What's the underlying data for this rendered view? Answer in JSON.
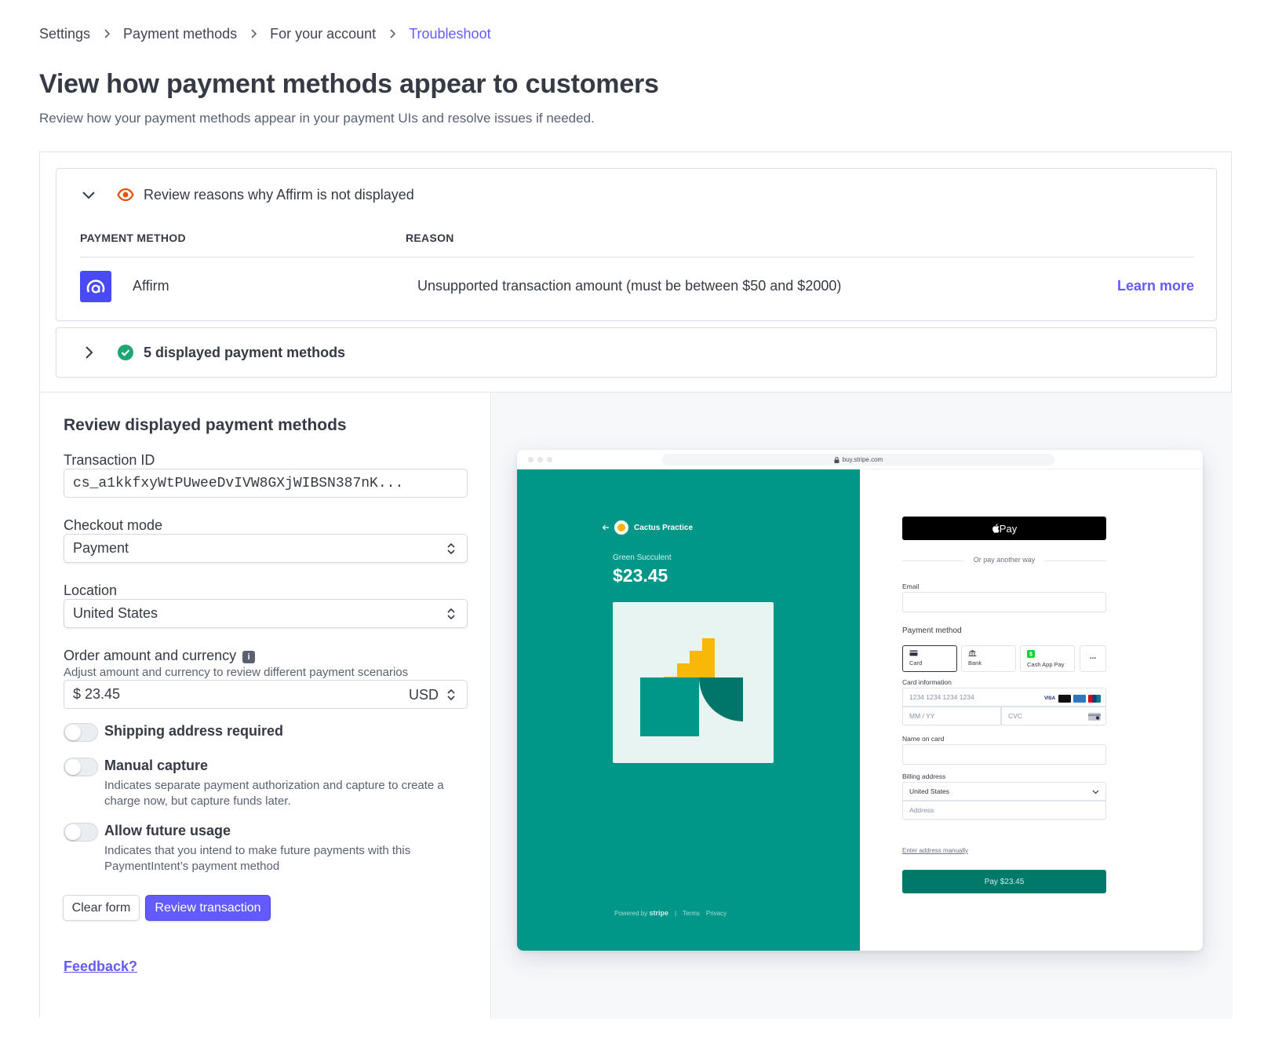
{
  "breadcrumb": {
    "items": [
      "Settings",
      "Payment methods",
      "For your account",
      "Troubleshoot"
    ]
  },
  "page": {
    "title": "View how payment methods appear to customers",
    "subtitle": "Review how your payment methods appear in your payment UIs and resolve issues if needed."
  },
  "issues": {
    "header": "Review reasons why Affirm is not displayed",
    "col_method": "PAYMENT METHOD",
    "col_reason": "REASON",
    "row": {
      "method": "Affirm",
      "reason": "Unsupported transaction amount (must be between $50 and $2000)",
      "link": "Learn more"
    }
  },
  "displayed": {
    "header": "5 displayed payment methods"
  },
  "form": {
    "title": "Review displayed payment methods",
    "transaction_label": "Transaction ID",
    "transaction_value": "cs_a1kkfxyWtPUweeDvIVW8GXjWIBSN387nK...",
    "checkout_label": "Checkout mode",
    "checkout_value": "Payment",
    "location_label": "Location",
    "location_value": "United States",
    "amount_label": "Order amount and currency",
    "amount_help": "Adjust amount and currency to review different payment scenarios",
    "amount_value": "$ 23.45",
    "currency_value": "USD",
    "toggles": [
      {
        "label": "Shipping address required",
        "desc": "",
        "on": false
      },
      {
        "label": "Manual capture",
        "desc": "Indicates separate payment authorization and capture to create a charge now, but capture funds later.",
        "on": false
      },
      {
        "label": "Allow future usage",
        "desc": "Indicates that you intend to make future payments with this PaymentIntent’s payment method",
        "on": false
      }
    ],
    "clear_button": "Clear form",
    "review_button": "Review transaction",
    "feedback": "Feedback?"
  },
  "preview": {
    "url": "buy.stripe.com",
    "merchant": "Cactus Practice",
    "product": "Green Succulent",
    "price": "$23.45",
    "apple_pay": "Pay",
    "or_text": "Or pay another way",
    "email_label": "Email",
    "payment_method_label": "Payment method",
    "tabs": [
      "Card",
      "Bank",
      "Cash App Pay",
      "..."
    ],
    "card_info_label": "Card information",
    "card_number_placeholder": "1234 1234 1234 1234",
    "expiry_placeholder": "MM / YY",
    "cvc_placeholder": "CVC",
    "name_label": "Name on card",
    "billing_label": "Billing address",
    "country": "United States",
    "address_placeholder": "Address",
    "enter_manually": "Enter address manually",
    "pay_button": "Pay $23.45",
    "powered_by": "Powered by",
    "powered_brand": "stripe",
    "terms": "Terms",
    "privacy": "Privacy"
  },
  "colors": {
    "accent": "#635bff",
    "affirm": "#4a4af4",
    "warning_eye": "#e5520d",
    "success": "#1ea672",
    "teal": "#009688"
  }
}
